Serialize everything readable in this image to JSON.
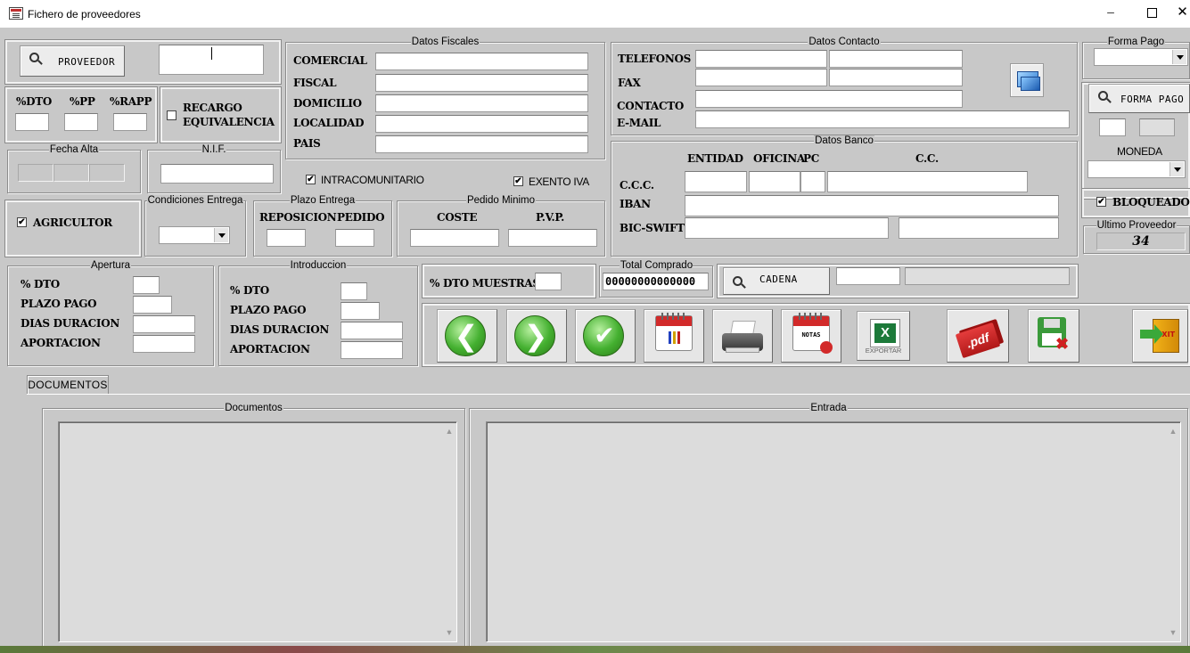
{
  "window": {
    "title": "Fichero de proveedores",
    "minimize": "–",
    "close": "✕"
  },
  "proveedor": {
    "button_label": "PROVEEDOR",
    "code": ""
  },
  "descuentos": {
    "dto_label": "%DTO",
    "pp_label": "%PP",
    "rapp_label": "%RAPP",
    "dto": "",
    "pp": "",
    "rapp": ""
  },
  "recargo": {
    "line1": "RECARGO",
    "line2": "EQUIVALENCIA",
    "checked": false
  },
  "fecha_alta": {
    "legend": "Fecha Alta",
    "day": "",
    "month": "",
    "year": ""
  },
  "nif": {
    "legend": "N.I.F.",
    "value": ""
  },
  "agricultor": {
    "label": "AGRICULTOR",
    "checked": true,
    "check_mark": "✔"
  },
  "condiciones_entrega": {
    "legend": "Condiciones Entrega",
    "selected": ""
  },
  "datos_fiscales": {
    "legend": "Datos Fiscales",
    "comercial_label": "COMERCIAL",
    "fiscal_label": "FISCAL",
    "domicilio_label": "DOMICILIO",
    "localidad_label": "LOCALIDAD",
    "pais_label": "PAIS",
    "comercial": "",
    "fiscal": "",
    "domicilio": "",
    "localidad": "",
    "pais": ""
  },
  "intracomunitario": {
    "label": "INTRACOMUNITARIO",
    "checked": true,
    "check_mark": "✔"
  },
  "exento_iva": {
    "label": "EXENTO IVA",
    "checked": true,
    "check_mark": "✔"
  },
  "plazo_entrega": {
    "legend": "Plazo Entrega",
    "reposicion_label": "REPOSICION",
    "pedido_label": "PEDIDO",
    "reposicion": "",
    "pedido": ""
  },
  "pedido_minimo": {
    "legend": "Pedido Minimo",
    "coste_label": "COSTE",
    "pvp_label": "P.V.P.",
    "coste": "",
    "pvp": ""
  },
  "datos_contacto": {
    "legend": "Datos Contacto",
    "telefonos_label": "TELEFONOS",
    "fax_label": "FAX",
    "contacto_label": "CONTACTO",
    "email_label": "E-MAIL",
    "telefono1": "",
    "telefono2": "",
    "fax1": "",
    "fax2": "",
    "contacto": "",
    "email": ""
  },
  "datos_banco": {
    "legend": "Datos Banco",
    "entidad_label": "ENTIDAD",
    "oficina_label": "OFICINA",
    "pc_label": "PC",
    "cc_label": "C.C.",
    "ccc_label": "C.C.C.",
    "iban_label": "IBAN",
    "bic_label": "BIC-SWIFT",
    "entidad": "",
    "oficina": "",
    "pc": "",
    "cc": "",
    "iban": "",
    "bic": "",
    "bic2": ""
  },
  "forma_pago": {
    "legend": "Forma Pago",
    "selected": "",
    "button_label": "FORMA PAGO",
    "code1": "",
    "code2": ""
  },
  "moneda": {
    "label": "MONEDA",
    "selected": ""
  },
  "bloqueado": {
    "label": "BLOQUEADO",
    "checked": true,
    "check_mark": "✔"
  },
  "ultimo_proveedor": {
    "legend": "Ultimo Proveedor",
    "value": "34"
  },
  "apertura": {
    "legend": "Apertura",
    "dto_label": "% DTO",
    "plazo_label": "PLAZO PAGO",
    "dias_label": "DIAS DURACION",
    "aportacion_label": "APORTACION",
    "dto": "",
    "plazo": "",
    "dias": "",
    "aportacion": ""
  },
  "introduccion": {
    "legend": "Introduccion",
    "dto_label": "% DTO",
    "plazo_label": "PLAZO PAGO",
    "dias_label": "DIAS DURACION",
    "aportacion_label": "APORTACION",
    "dto": "",
    "plazo": "",
    "dias": "",
    "aportacion": ""
  },
  "dto_muestras": {
    "label": "% DTO MUESTRAS",
    "value": ""
  },
  "total_comprado": {
    "legend": "Total Comprado Ejercicio",
    "value": "00000000000000"
  },
  "cadena": {
    "button_label": "CADENA",
    "code": "",
    "name": ""
  },
  "toolbar": {
    "buttons": [
      {
        "icon": "arrow-left-icon",
        "glyph": "❮"
      },
      {
        "icon": "arrow-right-icon",
        "glyph": "❯"
      },
      {
        "icon": "checkmark-icon",
        "glyph": "✔"
      },
      {
        "icon": "calendar-chart-icon"
      },
      {
        "icon": "printer-icon"
      },
      {
        "icon": "notes-calendar-icon",
        "text": "NOTAS"
      },
      {
        "icon": "excel-icon",
        "text": "EXPORTAR"
      },
      {
        "icon": "pdf-icon",
        "text": ".pdf"
      },
      {
        "icon": "floppy-delete-icon",
        "glyph": "✖"
      },
      {
        "icon": "exit-door-icon",
        "text": "EXIT"
      }
    ]
  },
  "tabs": [
    {
      "label": "DOCUMENTOS",
      "active": true
    }
  ],
  "documentos": {
    "legend": "Documentos",
    "items": []
  },
  "entrada": {
    "legend": "Entrada",
    "items": []
  },
  "scroll": {
    "up": "▲",
    "down": "▼"
  }
}
